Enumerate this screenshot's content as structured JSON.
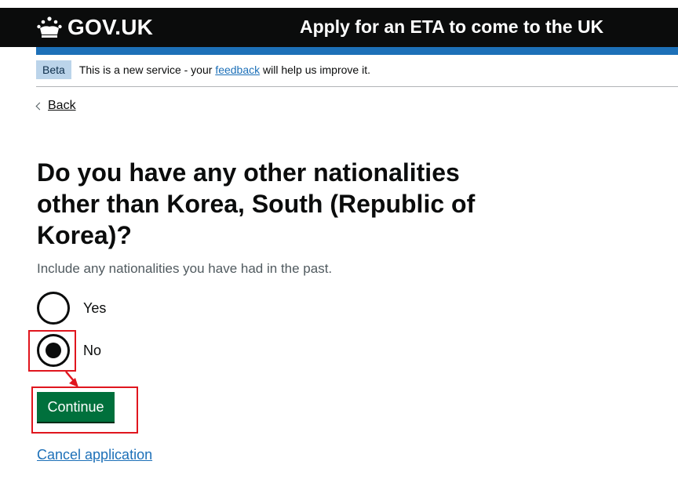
{
  "header": {
    "logo_text": "GOV.UK",
    "service_name": "Apply for an ETA to come to the UK"
  },
  "phase_banner": {
    "tag": "Beta",
    "text_before": "This is a new service - your ",
    "link": "feedback",
    "text_after": " will help us improve it."
  },
  "back_link": "Back",
  "question": {
    "heading": "Do you have any other nationalities other than Korea, South (Republic of Korea)?",
    "hint": "Include any nationalities you have had in the past.",
    "options": [
      {
        "label": "Yes",
        "selected": false
      },
      {
        "label": "No",
        "selected": true
      }
    ]
  },
  "continue_label": "Continue",
  "cancel_label": "Cancel application",
  "colors": {
    "header_bg": "#0b0c0c",
    "accent_blue": "#1d70b8",
    "button_green": "#00703c",
    "annotation_red": "#e0161e"
  }
}
